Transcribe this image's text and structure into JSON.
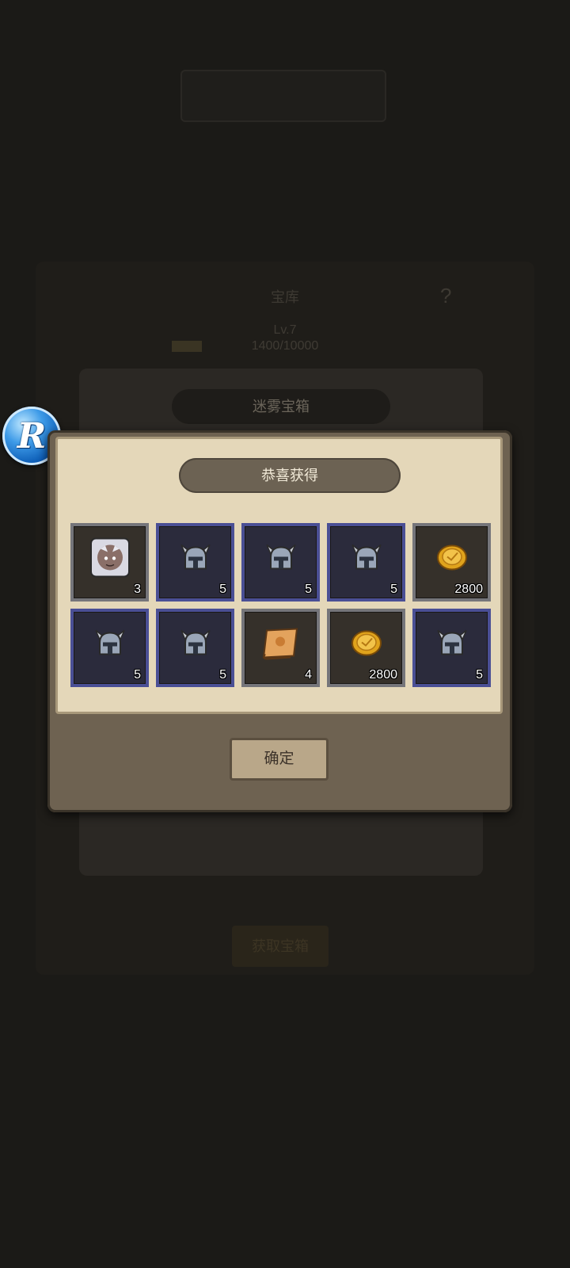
{
  "background": {
    "vault_title": "宝库",
    "help_mark": "?",
    "level": "Lv.7",
    "progress_text": "1400/10000",
    "chest_title": "迷雾宝箱",
    "red_notice": "",
    "bottom_button": "获取宝箱"
  },
  "dialog": {
    "title": "恭喜获得",
    "confirm_label": "确定",
    "rewards": [
      {
        "kind": "portrait",
        "frame": "gray",
        "count": "3"
      },
      {
        "kind": "helmet",
        "frame": "blue",
        "count": "5"
      },
      {
        "kind": "helmet",
        "frame": "blue",
        "count": "5"
      },
      {
        "kind": "helmet",
        "frame": "blue",
        "count": "5"
      },
      {
        "kind": "coin",
        "frame": "gray",
        "count": "2800"
      },
      {
        "kind": "helmet",
        "frame": "blue",
        "count": "5"
      },
      {
        "kind": "helmet",
        "frame": "blue",
        "count": "5"
      },
      {
        "kind": "scroll",
        "frame": "gray",
        "count": "4"
      },
      {
        "kind": "coin",
        "frame": "gray",
        "count": "2800"
      },
      {
        "kind": "helmet",
        "frame": "blue",
        "count": "5"
      }
    ]
  },
  "floating_button": {
    "letter": "R"
  }
}
